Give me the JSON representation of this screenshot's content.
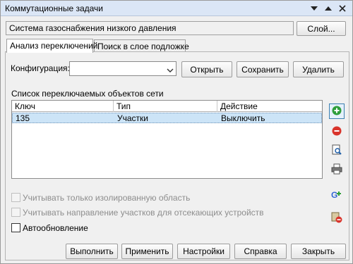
{
  "window": {
    "title": "Коммутационные задачи"
  },
  "system": {
    "value": "Система газоснабжения низкого давления",
    "layer_button": "Слой..."
  },
  "tabs": [
    {
      "label": "Анализ переключений",
      "active": true
    },
    {
      "label": "Поиск в слое подложке",
      "active": false
    }
  ],
  "config": {
    "label": "Конфигурация:",
    "value": "",
    "open_button": "Открыть",
    "save_button": "Сохранить",
    "delete_button": "Удалить"
  },
  "list": {
    "title": "Список переключаемых объектов сети",
    "columns": [
      "Ключ",
      "Тип",
      "Действие"
    ],
    "rows": [
      {
        "key": "135",
        "type": "Участки",
        "action": "Выключить",
        "selected": true
      }
    ]
  },
  "side_buttons": [
    {
      "icon": "add-icon"
    },
    {
      "icon": "remove-icon"
    },
    {
      "icon": "find-icon"
    },
    {
      "icon": "print-icon"
    },
    {
      "icon": "google-plus-icon"
    },
    {
      "icon": "layer-remove-icon"
    }
  ],
  "options": {
    "isolated_only": {
      "label": "Учитывать только изолированную область",
      "checked": false,
      "enabled": false
    },
    "direction": {
      "label": "Учитывать направление участков для отсекающих устройств",
      "checked": false,
      "enabled": false
    },
    "autoupdate": {
      "label": "Автообновление",
      "checked": false,
      "enabled": true
    }
  },
  "footer": {
    "run": "Выполнить",
    "apply": "Применить",
    "settings": "Настройки",
    "help": "Справка",
    "close": "Закрыть"
  },
  "colors": {
    "titlebar": "#dbe6f6",
    "selected_row": "#cce4f7",
    "add": "#2e9e3a",
    "remove": "#d9342b"
  }
}
